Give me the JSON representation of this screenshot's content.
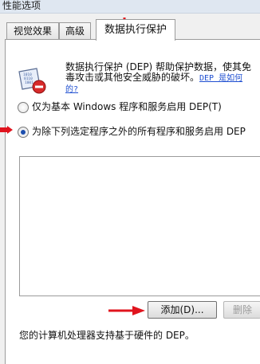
{
  "window": {
    "title": "性能选项"
  },
  "tabs": [
    {
      "label": "视觉效果"
    },
    {
      "label": "高级"
    },
    {
      "label": "数据执行保护"
    }
  ],
  "dep": {
    "description_line1": "数据执行保护 (DEP) 帮助保护数据，使其免",
    "description_line2": "毒攻击或其他安全威胁的破坏。",
    "link_part1": "DEP 是如何",
    "link_part2": "的?",
    "icon": "dep-shield-icon"
  },
  "options": {
    "option_basic": "仅为基本 Windows 程序和服务启用 DEP(T)",
    "option_all_except": "为除下列选定程序之外的所有程序和服务启用 DEP",
    "selected": "option_all_except"
  },
  "buttons": {
    "add": "添加(D)...",
    "remove": "删除"
  },
  "footer": {
    "support_text": "您的计算机处理器支持基于硬件的 DEP。"
  },
  "annotations": {
    "arrow_color": "#e0141e"
  }
}
